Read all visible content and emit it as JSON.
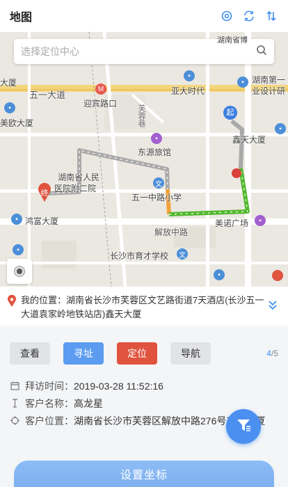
{
  "header": {
    "title": "地图",
    "icons": [
      "settings-icon",
      "refresh-icon",
      "sort-icon"
    ]
  },
  "map": {
    "search": {
      "placeholder": "选择定位中心"
    },
    "labels": {
      "road_wuyi": "五一大道",
      "yingbin": "迎宾路口",
      "yadashidai": "亚大时代",
      "hunan_first": "湖南第一",
      "design": "业设计研",
      "dasha": "大厦",
      "meiou": "美欧大厦",
      "xintian": "鑫天大厦",
      "dongyuan": "东源旅馆",
      "hospital1": "湖南省人民",
      "hospital2": "医院附二院",
      "wuyi_school": "五一中路小学",
      "honghu": "鸿富大厦",
      "meinuo": "美诺广场",
      "jiefang": "解放中路",
      "yucai": "长沙市育才学校",
      "furong": "芙蓉巷",
      "top_partial": "湖南省博"
    },
    "route_colors": {
      "gray": "#a9a9a9",
      "orange": "#f3a13a",
      "green": "#52b92e"
    },
    "markers": {
      "start": "起",
      "end": "终"
    }
  },
  "address": {
    "text": "我的位置：湖南省长沙市芙蓉区文艺路街道7天酒店(长沙五一大道袁家岭地铁站店)鑫天大厦"
  },
  "actions": {
    "view": "查看",
    "find": "寻址",
    "locate": "定位",
    "navigate": "导航",
    "page_current": "4",
    "page_total": "/5"
  },
  "info": {
    "visit_label": "拜访时间：",
    "visit_value": "2019-03-28 11:52:16",
    "customer_label": "客户名称：",
    "customer_value": "高龙星",
    "position_label": "客户位置：",
    "position_value": "湖南省长沙市芙蓉区解放中路276号鑫天大厦"
  },
  "set_coords": "设置坐标"
}
